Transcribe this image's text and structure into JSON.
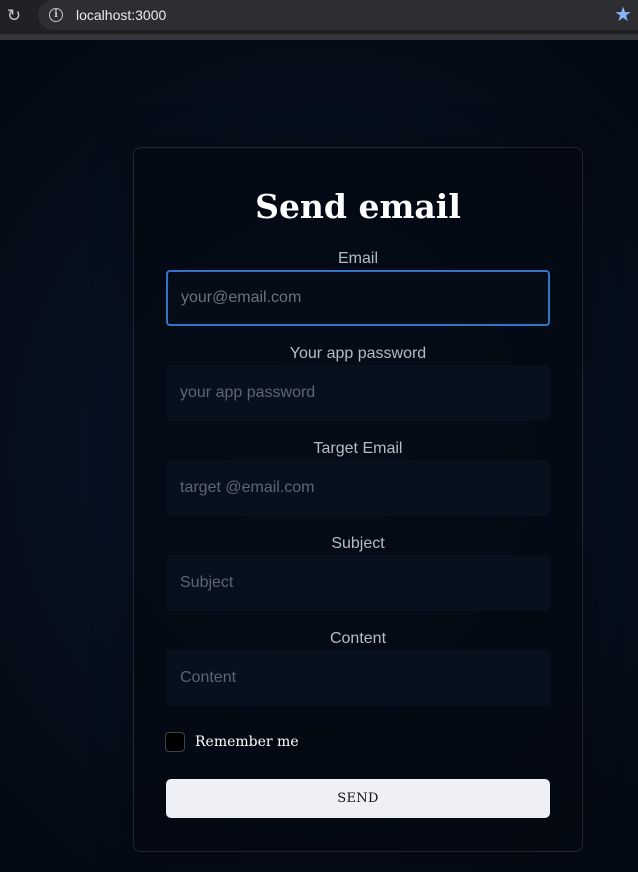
{
  "browser": {
    "url": "localhost:3000",
    "reload_icon": "reload-icon",
    "info_icon": "info-icon",
    "star_icon": "bookmark-star-icon"
  },
  "form": {
    "title": "Send email",
    "fields": [
      {
        "label": "Email",
        "placeholder": "your@email.com",
        "value": ""
      },
      {
        "label": "Your app password",
        "placeholder": "your app password",
        "value": ""
      },
      {
        "label": "Target Email",
        "placeholder": "target @email.com",
        "value": ""
      },
      {
        "label": "Subject",
        "placeholder": "Subject",
        "value": ""
      },
      {
        "label": "Content",
        "placeholder": "Content",
        "value": ""
      }
    ],
    "remember_label": "Remember me",
    "remember_checked": false,
    "send_label": "SEND"
  },
  "colors": {
    "background": "#050b14",
    "card_border": "#1f2733",
    "focus_border": "#2f74c8",
    "button_bg": "#eef0f6",
    "star": "#8ab4f8"
  }
}
